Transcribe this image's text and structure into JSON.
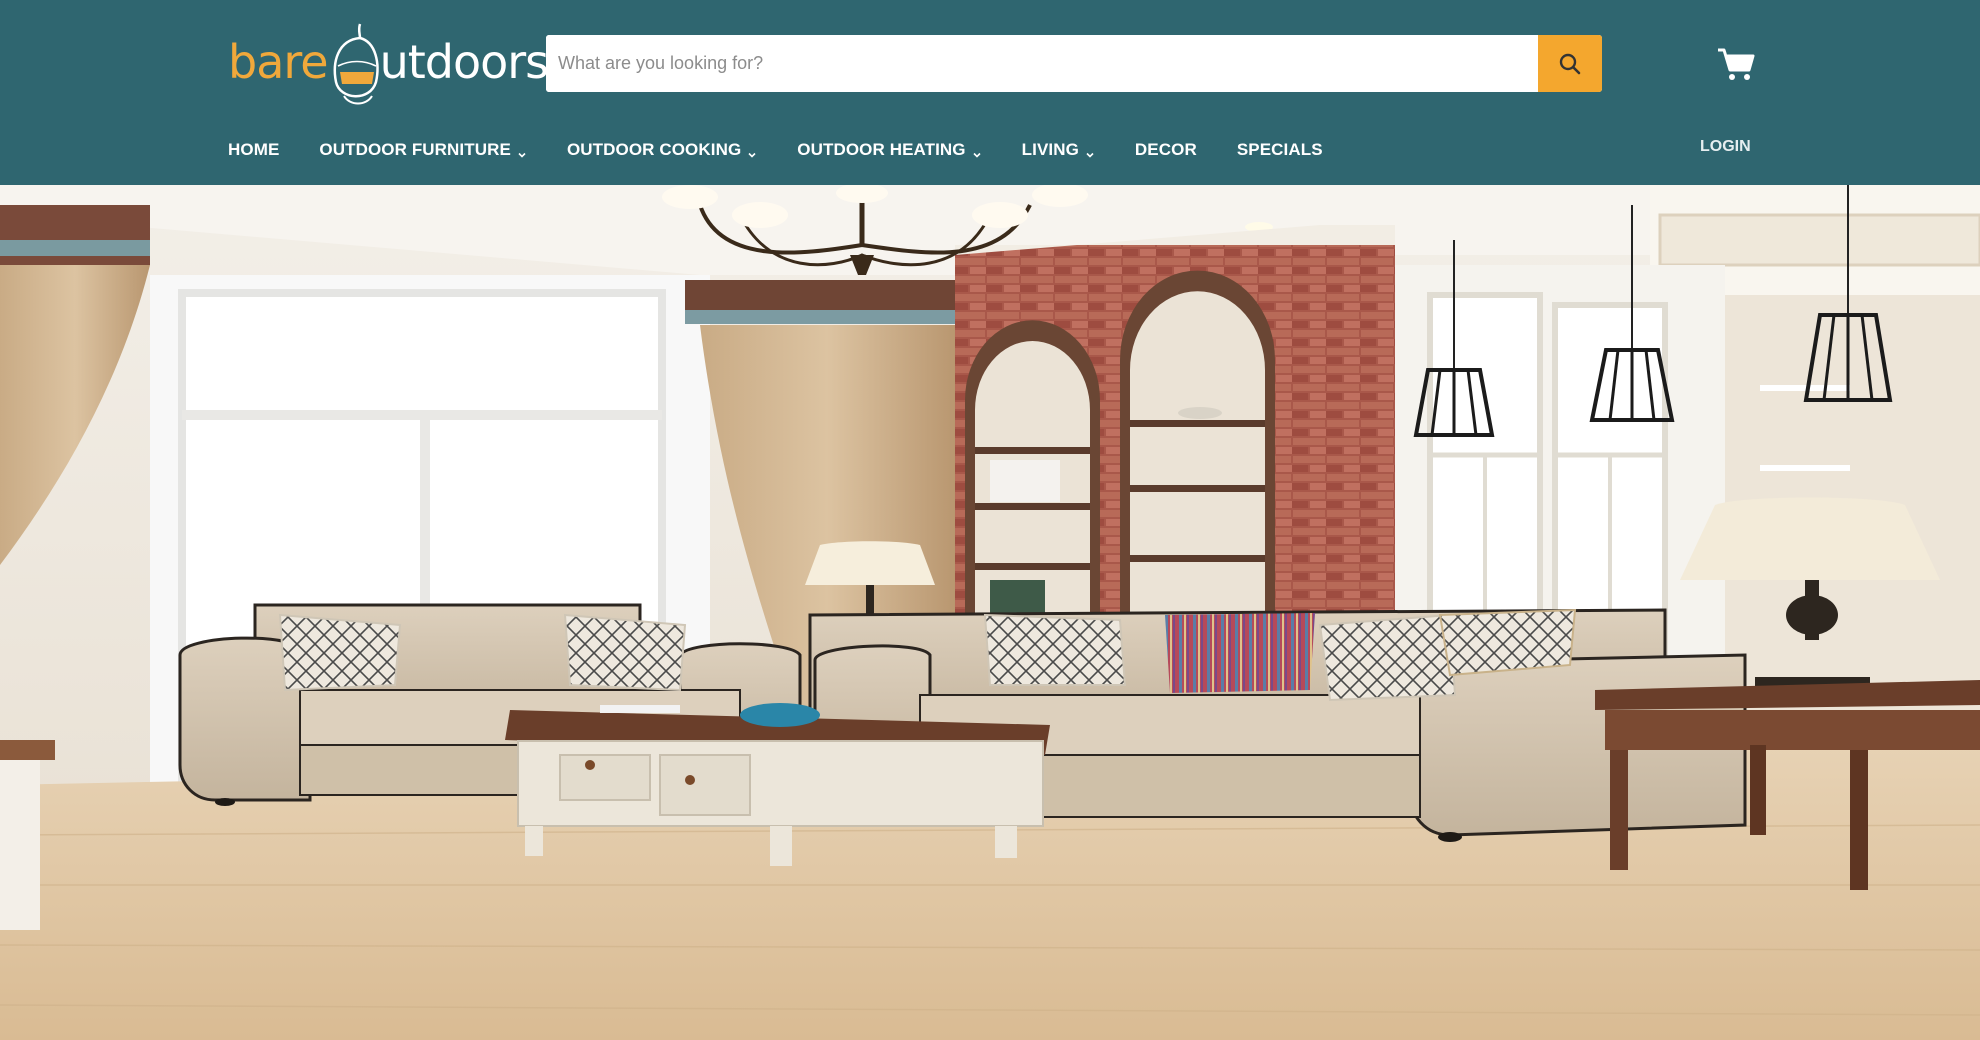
{
  "brand": {
    "part1": "bare",
    "part2": "utdoors"
  },
  "search": {
    "placeholder": "What are you looking for?",
    "value": ""
  },
  "nav": {
    "items": [
      {
        "label": "HOME",
        "dropdown": false
      },
      {
        "label": "OUTDOOR FURNITURE",
        "dropdown": true
      },
      {
        "label": "OUTDOOR COOKING",
        "dropdown": true
      },
      {
        "label": "OUTDOOR HEATING",
        "dropdown": true
      },
      {
        "label": "LIVING",
        "dropdown": true
      },
      {
        "label": "DECOR",
        "dropdown": false
      },
      {
        "label": "SPECIALS",
        "dropdown": false
      }
    ],
    "login": "LOGIN"
  },
  "icons": {
    "search": "search-icon",
    "cart": "cart-icon",
    "chevron": "chevron-down-icon"
  },
  "colors": {
    "header_bg": "#2f6670",
    "accent": "#f4a72e",
    "logo_orange": "#f0a83b"
  }
}
